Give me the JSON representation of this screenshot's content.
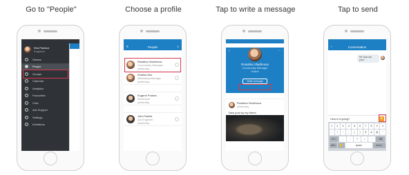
{
  "steps": [
    {
      "title": "Go to \"People\""
    },
    {
      "title": "Choose a profile"
    },
    {
      "title": "Tap to write a message"
    },
    {
      "title": "Tap to send"
    }
  ],
  "menu": {
    "user_name": "Kira Pavlova",
    "user_sub": "Engineer",
    "items": [
      "Stream",
      "People",
      "Groups",
      "Calendar",
      "Analytics",
      "Favourites",
      "Chat",
      "Ask Support",
      "Settings",
      "Invitations"
    ],
    "active_index": 1
  },
  "people": {
    "nav_title": "People",
    "list": [
      {
        "name": "Rosalina Vladimova",
        "role": "Community Manager",
        "sub": "yesterday"
      },
      {
        "name": "Kristina Mor",
        "role": "Marketing Manager",
        "sub": "yesterday"
      },
      {
        "name": "Eugene Protsev",
        "role": "Developer",
        "sub": "yesterday"
      },
      {
        "name": "John Sasha",
        "role": "QA Engineer",
        "sub": "yesterday"
      }
    ]
  },
  "profile": {
    "name": "Rosalina Vladimova",
    "role": "Community Manager",
    "status": "Online",
    "message_button": "Write message",
    "post_author": "Rosalina Vladimova",
    "post_time": "yesterday",
    "post_text": "New post by my friend"
  },
  "chat": {
    "nav_title": "Conversation",
    "bubble": "Hi! How are you?",
    "compose_text": "How is it going?",
    "send_icon": "send-arrow-icon",
    "keys_row1": [
      "1",
      "2",
      "3",
      "4",
      "5",
      "6",
      "7",
      "8",
      "9",
      "0"
    ],
    "keys_row2": [
      "-",
      "/",
      ":",
      ";",
      "(",
      ")",
      "$",
      "&",
      "@",
      "\""
    ],
    "keys_row3": [
      "#+=",
      ".",
      ",",
      "?",
      "!",
      "'",
      "⌫"
    ],
    "keys_row4": [
      "ABC",
      "🙂",
      "space",
      "return"
    ]
  },
  "colors": {
    "accent": "#1d7fc4",
    "highlight": "#d83a4b",
    "menu_bg": "#2f3338"
  }
}
